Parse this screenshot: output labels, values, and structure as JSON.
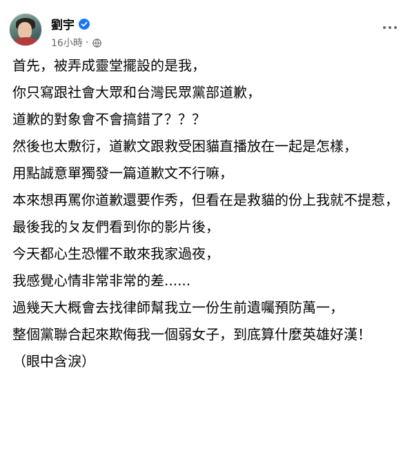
{
  "author": {
    "name": "劉宇"
  },
  "meta": {
    "timestamp": "16小時",
    "separator": "·"
  },
  "icons": {
    "verified": "verified-badge-icon",
    "privacy": "globe-icon",
    "more": "more-options-icon"
  },
  "colors": {
    "verified": "#1877f2",
    "meta_text": "#65676b",
    "body_text": "#050505"
  },
  "post": {
    "paragraphs": [
      "首先，被弄成靈堂擺設的是我，",
      "你只寫跟社會大眾和台灣民眾黨部道歉，",
      "道歉的對象會不會搞錯了？？？",
      "然後也太敷衍，道歉文跟救受困貓直播放在一起是怎樣，",
      "用點誠意單獨發一篇道歉文不行嘛，",
      "本來想再罵你道歉還要作秀，但看在是救貓的份上我就不提惹，",
      "最後我的ㄆ友們看到你的影片後，",
      "今天都心生恐懼不敢來我家過夜，",
      "我感覺心情非常非常的差......",
      "過幾天大概會去找律師幫我立一份生前遺囑預防萬一，",
      "整個黨聯合起來欺侮我一個弱女子，到底算什麼英雄好漢！",
      "（眼中含淚）"
    ]
  }
}
